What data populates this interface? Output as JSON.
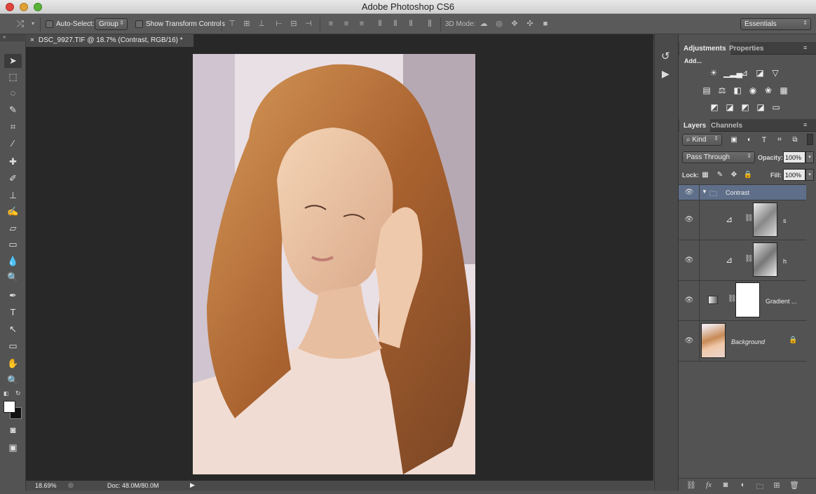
{
  "window": {
    "title": "Adobe Photoshop CS6"
  },
  "options": {
    "auto_select_label": "Auto-Select:",
    "auto_select_value": "Group",
    "show_transform_label": "Show Transform Controls",
    "mode_3d_label": "3D Mode:",
    "workspace": "Essentials"
  },
  "document": {
    "tab_title": "DSC_9927.TIF @ 18.7% (Contrast, RGB/16) *",
    "zoom": "18.69%",
    "doc_size": "Doc: 48.0M/80.0M"
  },
  "adjustments": {
    "tabs": [
      "Adjustments",
      "Properties"
    ],
    "add_label": "Add...",
    "icons": [
      [
        "brightness-contrast",
        "levels",
        "curves",
        "exposure",
        "vibrance"
      ],
      [
        "hue-saturation",
        "color-balance",
        "black-white",
        "photo-filter",
        "channel-mixer",
        "color-lookup"
      ],
      [
        "invert",
        "posterize",
        "threshold",
        "selective-color",
        "gradient-map"
      ]
    ]
  },
  "layers_panel": {
    "tabs": [
      "Layers",
      "Channels"
    ],
    "filter_kind": "Kind",
    "blend_mode": "Pass Through",
    "opacity_label": "Opacity:",
    "opacity_value": "100%",
    "lock_label": "Lock:",
    "fill_label": "Fill:",
    "fill_value": "100%",
    "layers": [
      {
        "name": "Contrast",
        "type": "group",
        "selected": true
      },
      {
        "name": "s",
        "type": "curves-adjustment"
      },
      {
        "name": "h",
        "type": "curves-adjustment"
      },
      {
        "name": "Gradient ...",
        "type": "gradient-fill"
      },
      {
        "name": "Background",
        "type": "image",
        "locked": true
      }
    ]
  }
}
